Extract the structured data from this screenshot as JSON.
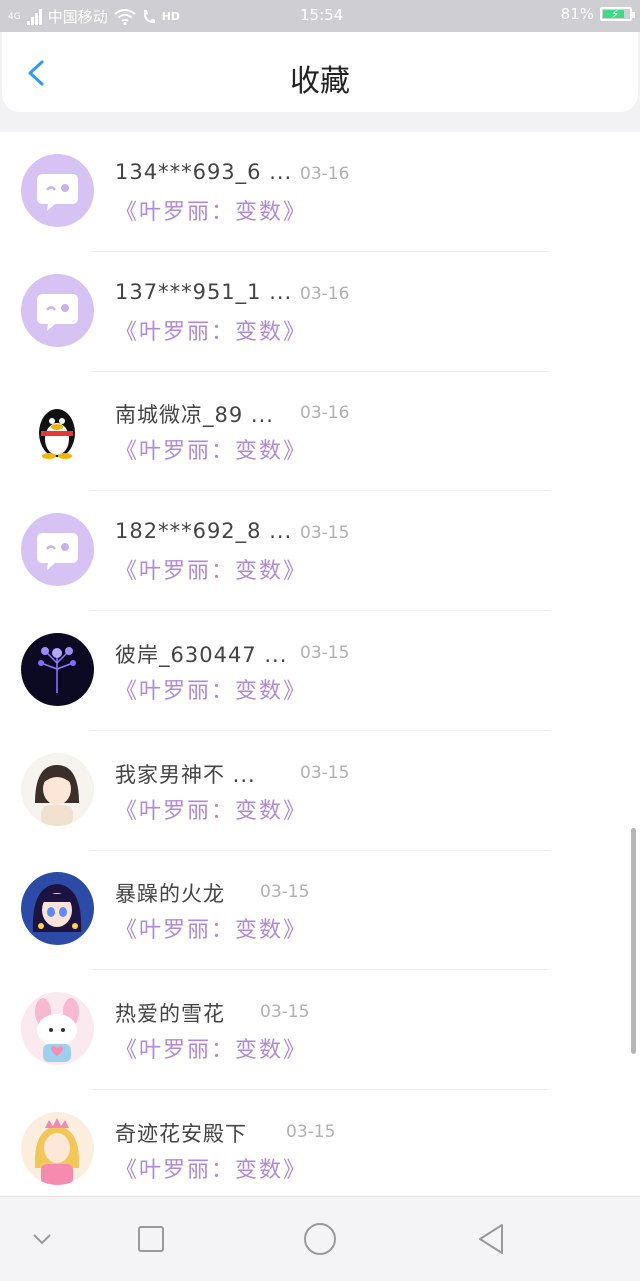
{
  "status_bar": {
    "carrier": "中国移动",
    "network": "4G",
    "hd": "HD",
    "time": "15:54",
    "battery": "81%",
    "battery_level": 0.81
  },
  "header": {
    "title": "收藏",
    "back_icon": "chevron-left-icon"
  },
  "colors": {
    "accent": "#2e9bf0",
    "work_title": "#b08ad6",
    "avatar_default_bg": "#d6c3f3"
  },
  "items": [
    {
      "name": "134***693_6 ...",
      "date": "03-16",
      "work": "《叶罗丽：变数》",
      "avatar": "default-chat-avatar"
    },
    {
      "name": "137***951_1 ...",
      "date": "03-16",
      "work": "《叶罗丽：变数》",
      "avatar": "default-chat-avatar"
    },
    {
      "name": "南城微凉_89 ...",
      "date": "03-16",
      "work": "《叶罗丽：变数》",
      "avatar": "penguin-avatar"
    },
    {
      "name": "182***692_8 ...",
      "date": "03-15",
      "work": "《叶罗丽：变数》",
      "avatar": "default-chat-avatar"
    },
    {
      "name": "彼岸_630447 ...",
      "date": "03-15",
      "work": "《叶罗丽：变数》",
      "avatar": "purple-flower-avatar"
    },
    {
      "name": "我家男神不 ...",
      "date": "03-15",
      "work": "《叶罗丽：变数》",
      "avatar": "anime-girl-avatar"
    },
    {
      "name": "暴躁的火龙",
      "date": "03-15",
      "work": "《叶罗丽：变数》",
      "avatar": "doll-girl-avatar"
    },
    {
      "name": "热爱的雪花",
      "date": "03-15",
      "work": "《叶罗丽：变数》",
      "avatar": "pink-bunny-avatar"
    },
    {
      "name": "奇迹花安殿下",
      "date": "03-15",
      "work": "《叶罗丽：变数》",
      "avatar": "princess-avatar"
    }
  ],
  "nav_bar": {
    "buttons": [
      "chevron-down-icon",
      "recents-square-icon",
      "home-circle-icon",
      "back-triangle-icon"
    ]
  }
}
